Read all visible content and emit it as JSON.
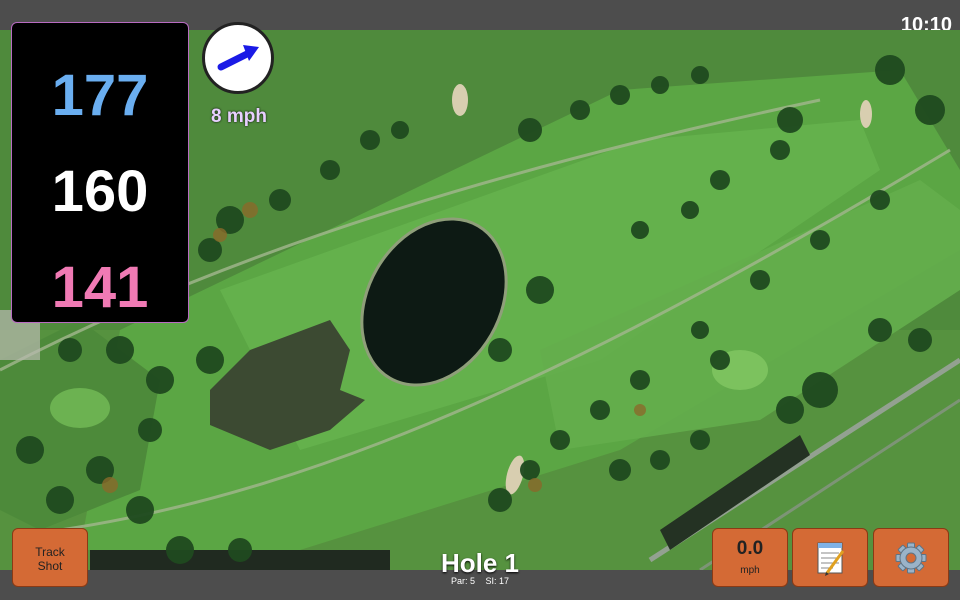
{
  "status": {
    "time": "10:10"
  },
  "distances": {
    "back": "177",
    "middle": "160",
    "front": "141"
  },
  "wind": {
    "speed_label": "8 mph",
    "icon": "wind-direction-arrow-icon",
    "arrow_color": "#1a1ae6"
  },
  "hole": {
    "title": "Hole 1",
    "par": "Par: 5",
    "stroke_index": "SI: 17"
  },
  "buttons": {
    "track_shot": "Track Shot",
    "wind_value": "0.0",
    "wind_unit": "mph",
    "notes_icon": "notepad-icon",
    "settings_icon": "gear-icon"
  },
  "colors": {
    "back_distance": "#6aaef0",
    "middle_distance": "#ffffff",
    "front_distance": "#f07ab4",
    "button": "#d46a35"
  }
}
